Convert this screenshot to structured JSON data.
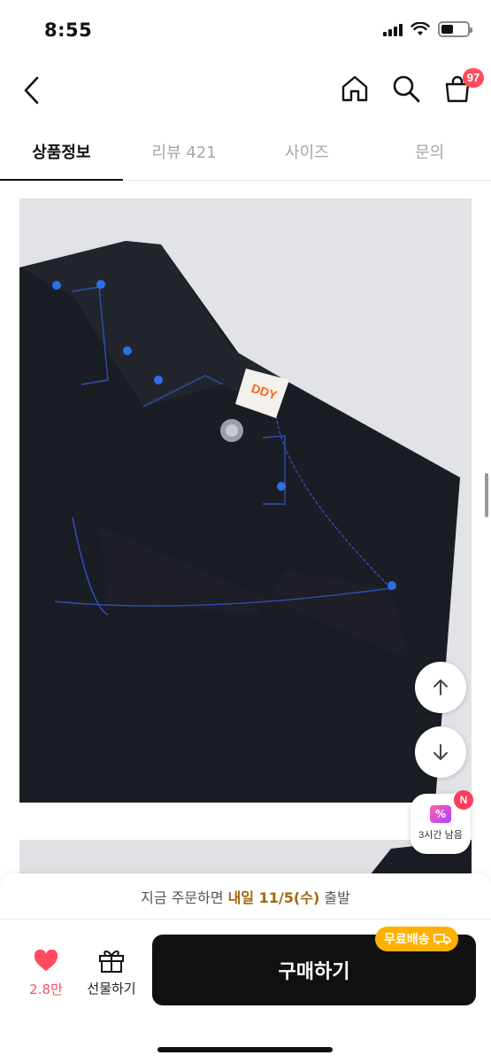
{
  "status_bar": {
    "time": "8:55",
    "icons": [
      "signal-icon",
      "wifi-icon",
      "battery-icon"
    ]
  },
  "header": {
    "icons": [
      "back-icon",
      "home-icon",
      "search-icon",
      "cart-icon"
    ],
    "cart_count": "97"
  },
  "tabs": [
    {
      "label": "상품정보",
      "active": true
    },
    {
      "label": "리뷰 421",
      "active": false
    },
    {
      "label": "사이즈",
      "active": false
    },
    {
      "label": "문의",
      "active": false
    }
  ],
  "product": {
    "image_logo_text": "DDY"
  },
  "floating": {
    "icons": [
      "arrow-up-icon",
      "arrow-down-icon"
    ],
    "coupon_badge": "N",
    "coupon_icon_text": "%",
    "coupon_label": "3시간 남음"
  },
  "bottom_bar": {
    "delivery_prefix": "지금 주문하면 ",
    "delivery_highlight": "내일 11/5(수)",
    "delivery_suffix": " 출발",
    "like_count": "2.8만",
    "gift_label": "선물하기",
    "buy_label": "구매하기",
    "free_shipping_label": "무료배송"
  },
  "colors": {
    "accent_red": "#ff4b5c",
    "delivery_highlight": "#a3670c",
    "free_shipping": "#ffb000",
    "buy_button": "#111111"
  }
}
